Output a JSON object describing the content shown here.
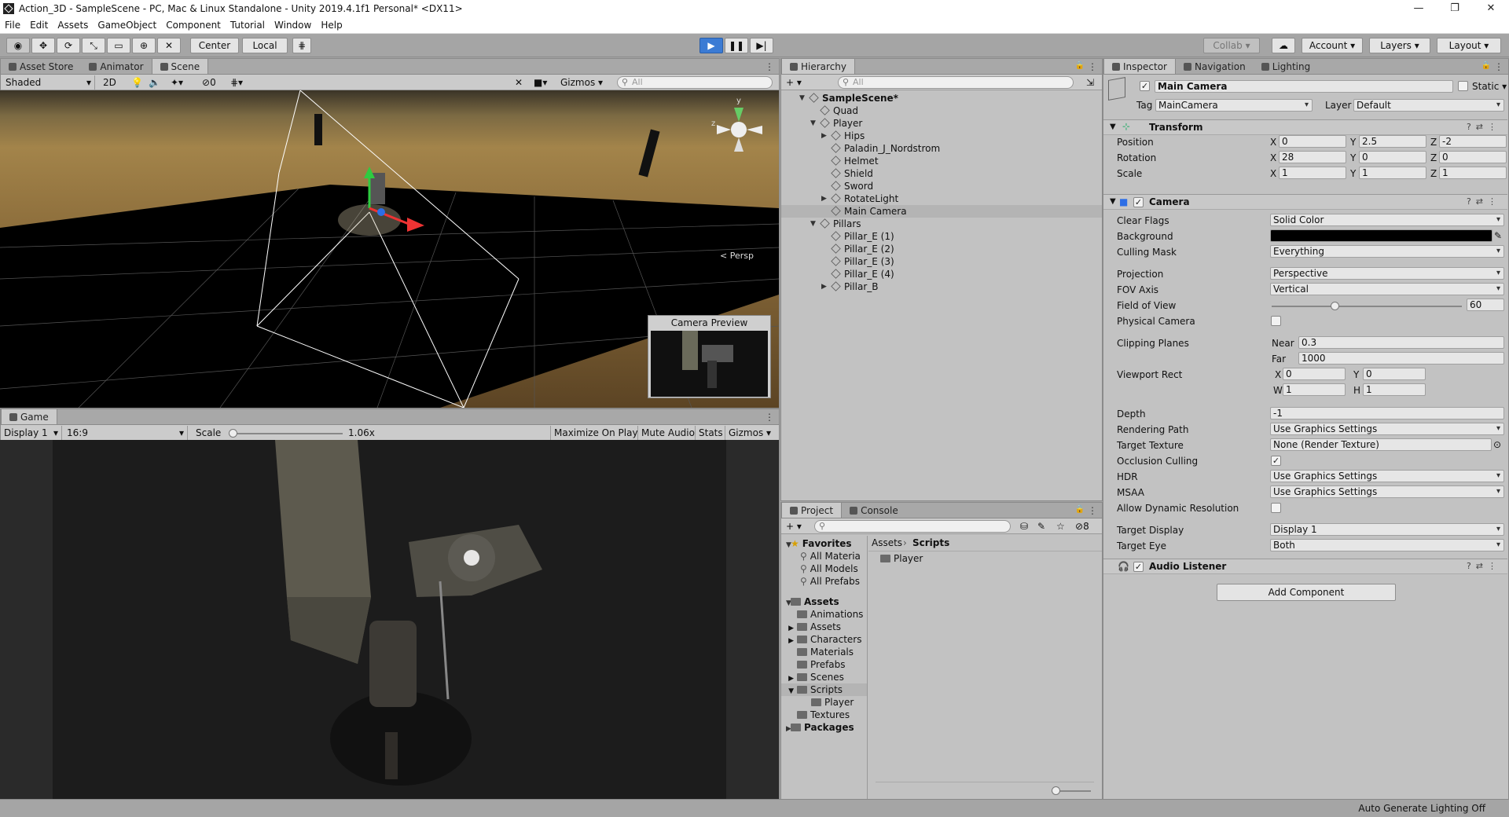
{
  "window": {
    "title": "Action_3D - SampleScene - PC, Mac & Linux Standalone - Unity 2019.4.1f1 Personal* <DX11>",
    "controls": [
      "—",
      "❐",
      "✕"
    ]
  },
  "menu": [
    "File",
    "Edit",
    "Assets",
    "GameObject",
    "Component",
    "Tutorial",
    "Window",
    "Help"
  ],
  "toolbar": {
    "pivot": "Center",
    "space": "Local",
    "collab": "Collab",
    "account": "Account",
    "layers": "Layers",
    "layout": "Layout"
  },
  "scene_panel": {
    "tabs": [
      "Asset Store",
      "Animator",
      "Scene"
    ],
    "shading": "Shaded",
    "mode_2d": "2D",
    "hidden_count": "0",
    "gizmos": "Gizmos",
    "search_placeholder": "All",
    "persp_label": "< Persp",
    "camera_preview": "Camera Preview",
    "accent": "#3b7bd4"
  },
  "game_panel": {
    "tab": "Game",
    "display": "Display 1",
    "aspect": "16:9",
    "scale_label": "Scale",
    "scale_value": "1.06x",
    "buttons": [
      "Maximize On Play",
      "Mute Audio",
      "Stats",
      "Gizmos"
    ]
  },
  "hierarchy": {
    "tab": "Hierarchy",
    "search_placeholder": "All",
    "items": [
      {
        "label": "SampleScene*",
        "depth": 0,
        "arrow": "▼",
        "bold": true
      },
      {
        "label": "Quad",
        "depth": 1,
        "arrow": ""
      },
      {
        "label": "Player",
        "depth": 1,
        "arrow": "▼"
      },
      {
        "label": "Hips",
        "depth": 2,
        "arrow": "▶"
      },
      {
        "label": "Paladin_J_Nordstrom",
        "depth": 2,
        "arrow": ""
      },
      {
        "label": "Helmet",
        "depth": 2,
        "arrow": ""
      },
      {
        "label": "Shield",
        "depth": 2,
        "arrow": ""
      },
      {
        "label": "Sword",
        "depth": 2,
        "arrow": ""
      },
      {
        "label": "RotateLight",
        "depth": 2,
        "arrow": "▶"
      },
      {
        "label": "Main Camera",
        "depth": 2,
        "arrow": "",
        "selected": true
      },
      {
        "label": "Pillars",
        "depth": 1,
        "arrow": "▼"
      },
      {
        "label": "Pillar_E (1)",
        "depth": 2,
        "arrow": ""
      },
      {
        "label": "Pillar_E (2)",
        "depth": 2,
        "arrow": ""
      },
      {
        "label": "Pillar_E (3)",
        "depth": 2,
        "arrow": ""
      },
      {
        "label": "Pillar_E (4)",
        "depth": 2,
        "arrow": ""
      },
      {
        "label": "Pillar_B",
        "depth": 2,
        "arrow": "▶"
      }
    ]
  },
  "project": {
    "tabs": [
      "Project",
      "Console"
    ],
    "hidden_count": "8",
    "breadcrumb": [
      "Assets",
      "Scripts"
    ],
    "favorites_label": "Favorites",
    "favorites": [
      "All Materia",
      "All Models",
      "All Prefabs"
    ],
    "assets_label": "Assets",
    "folders": [
      {
        "label": "Animations",
        "arrow": ""
      },
      {
        "label": "Assets",
        "arrow": "▶"
      },
      {
        "label": "Characters",
        "arrow": "▶"
      },
      {
        "label": "Materials",
        "arrow": ""
      },
      {
        "label": "Prefabs",
        "arrow": ""
      },
      {
        "label": "Scenes",
        "arrow": "▶"
      },
      {
        "label": "Scripts",
        "arrow": "▼",
        "selected": true
      },
      {
        "label": "Player",
        "arrow": "",
        "sub": true
      },
      {
        "label": "Textures",
        "arrow": ""
      }
    ],
    "packages_label": "Packages",
    "content": [
      "Player"
    ]
  },
  "inspector": {
    "tabs": [
      "Inspector",
      "Navigation",
      "Lighting"
    ],
    "object_name": "Main Camera",
    "static_label": "Static",
    "tag_label": "Tag",
    "tag_value": "MainCamera",
    "layer_label": "Layer",
    "layer_value": "Default",
    "transform": {
      "title": "Transform",
      "position_label": "Position",
      "position": [
        "0",
        "2.5",
        "-2"
      ],
      "rotation_label": "Rotation",
      "rotation": [
        "28",
        "0",
        "0"
      ],
      "scale_label": "Scale",
      "scale": [
        "1",
        "1",
        "1"
      ],
      "axes": [
        "X",
        "Y",
        "Z"
      ]
    },
    "camera": {
      "title": "Camera",
      "clear_flags_label": "Clear Flags",
      "clear_flags": "Solid Color",
      "background_label": "Background",
      "background_color": "#000000",
      "culling_mask_label": "Culling Mask",
      "culling_mask": "Everything",
      "projection_label": "Projection",
      "projection": "Perspective",
      "fov_axis_label": "FOV Axis",
      "fov_axis": "Vertical",
      "fov_label": "Field of View",
      "fov": "60",
      "fov_fraction": 0.33,
      "physical_label": "Physical Camera",
      "clipping_label": "Clipping Planes",
      "near_label": "Near",
      "near": "0.3",
      "far_label": "Far",
      "far": "1000",
      "viewport_label": "Viewport Rect",
      "vp_x_label": "X",
      "vp_x": "0",
      "vp_y_label": "Y",
      "vp_y": "0",
      "vp_w_label": "W",
      "vp_w": "1",
      "vp_h_label": "H",
      "vp_h": "1",
      "depth_label": "Depth",
      "depth": "-1",
      "rendering_path_label": "Rendering Path",
      "rendering_path": "Use Graphics Settings",
      "target_texture_label": "Target Texture",
      "target_texture": "None (Render Texture)",
      "occlusion_label": "Occlusion Culling",
      "hdr_label": "HDR",
      "hdr": "Use Graphics Settings",
      "msaa_label": "MSAA",
      "msaa": "Use Graphics Settings",
      "dynres_label": "Allow Dynamic Resolution",
      "target_display_label": "Target Display",
      "target_display": "Display 1",
      "target_eye_label": "Target Eye",
      "target_eye": "Both"
    },
    "audio_listener": "Audio Listener",
    "add_component": "Add Component"
  },
  "status": {
    "text": "Auto Generate Lighting Off"
  }
}
